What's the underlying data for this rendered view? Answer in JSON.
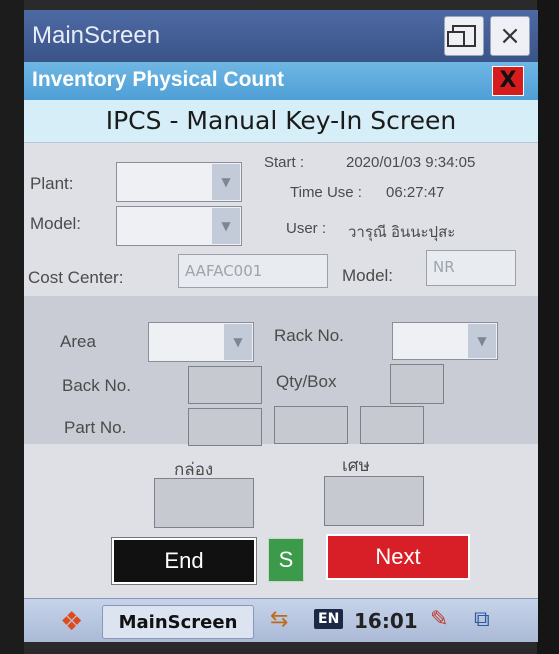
{
  "window": {
    "title": "MainScreen",
    "restore_icon": "restore-window-icon",
    "close_label": "×"
  },
  "header": {
    "title": "Inventory Physical Count",
    "close_label": "X",
    "subtitle": "IPCS - Manual Key-In Screen"
  },
  "form": {
    "plant_label": "Plant:",
    "model_label": "Model:",
    "plant_value": "",
    "model_value": "",
    "start_label": "Start :",
    "start_value": "2020/01/03 9:34:05",
    "time_use_label": "Time Use :",
    "time_use_value": "06:27:47",
    "user_label": "User :",
    "user_value": "วารุณี อินนะปุสะ",
    "cost_center_label": "Cost Center:",
    "cost_center_value": "AAFAC001",
    "model2_label": "Model:",
    "model2_value": "NR"
  },
  "panel": {
    "area_label": "Area",
    "rack_no_label": "Rack No.",
    "back_no_label": "Back No.",
    "qty_box_label": "Qty/Box",
    "part_no_label": "Part No."
  },
  "count": {
    "box_label": "กล่อง",
    "scrap_label": "เศษ"
  },
  "buttons": {
    "end": "End",
    "s": "S",
    "next": "Next"
  },
  "taskbar": {
    "app_label": "MainScreen",
    "language": "EN",
    "time": "16:01"
  },
  "colors": {
    "titlebar": "#4e6aa4",
    "header": "#5aa7dc",
    "end_button": "#111111",
    "s_button": "#3c9a4b",
    "next_button": "#d81e26"
  }
}
